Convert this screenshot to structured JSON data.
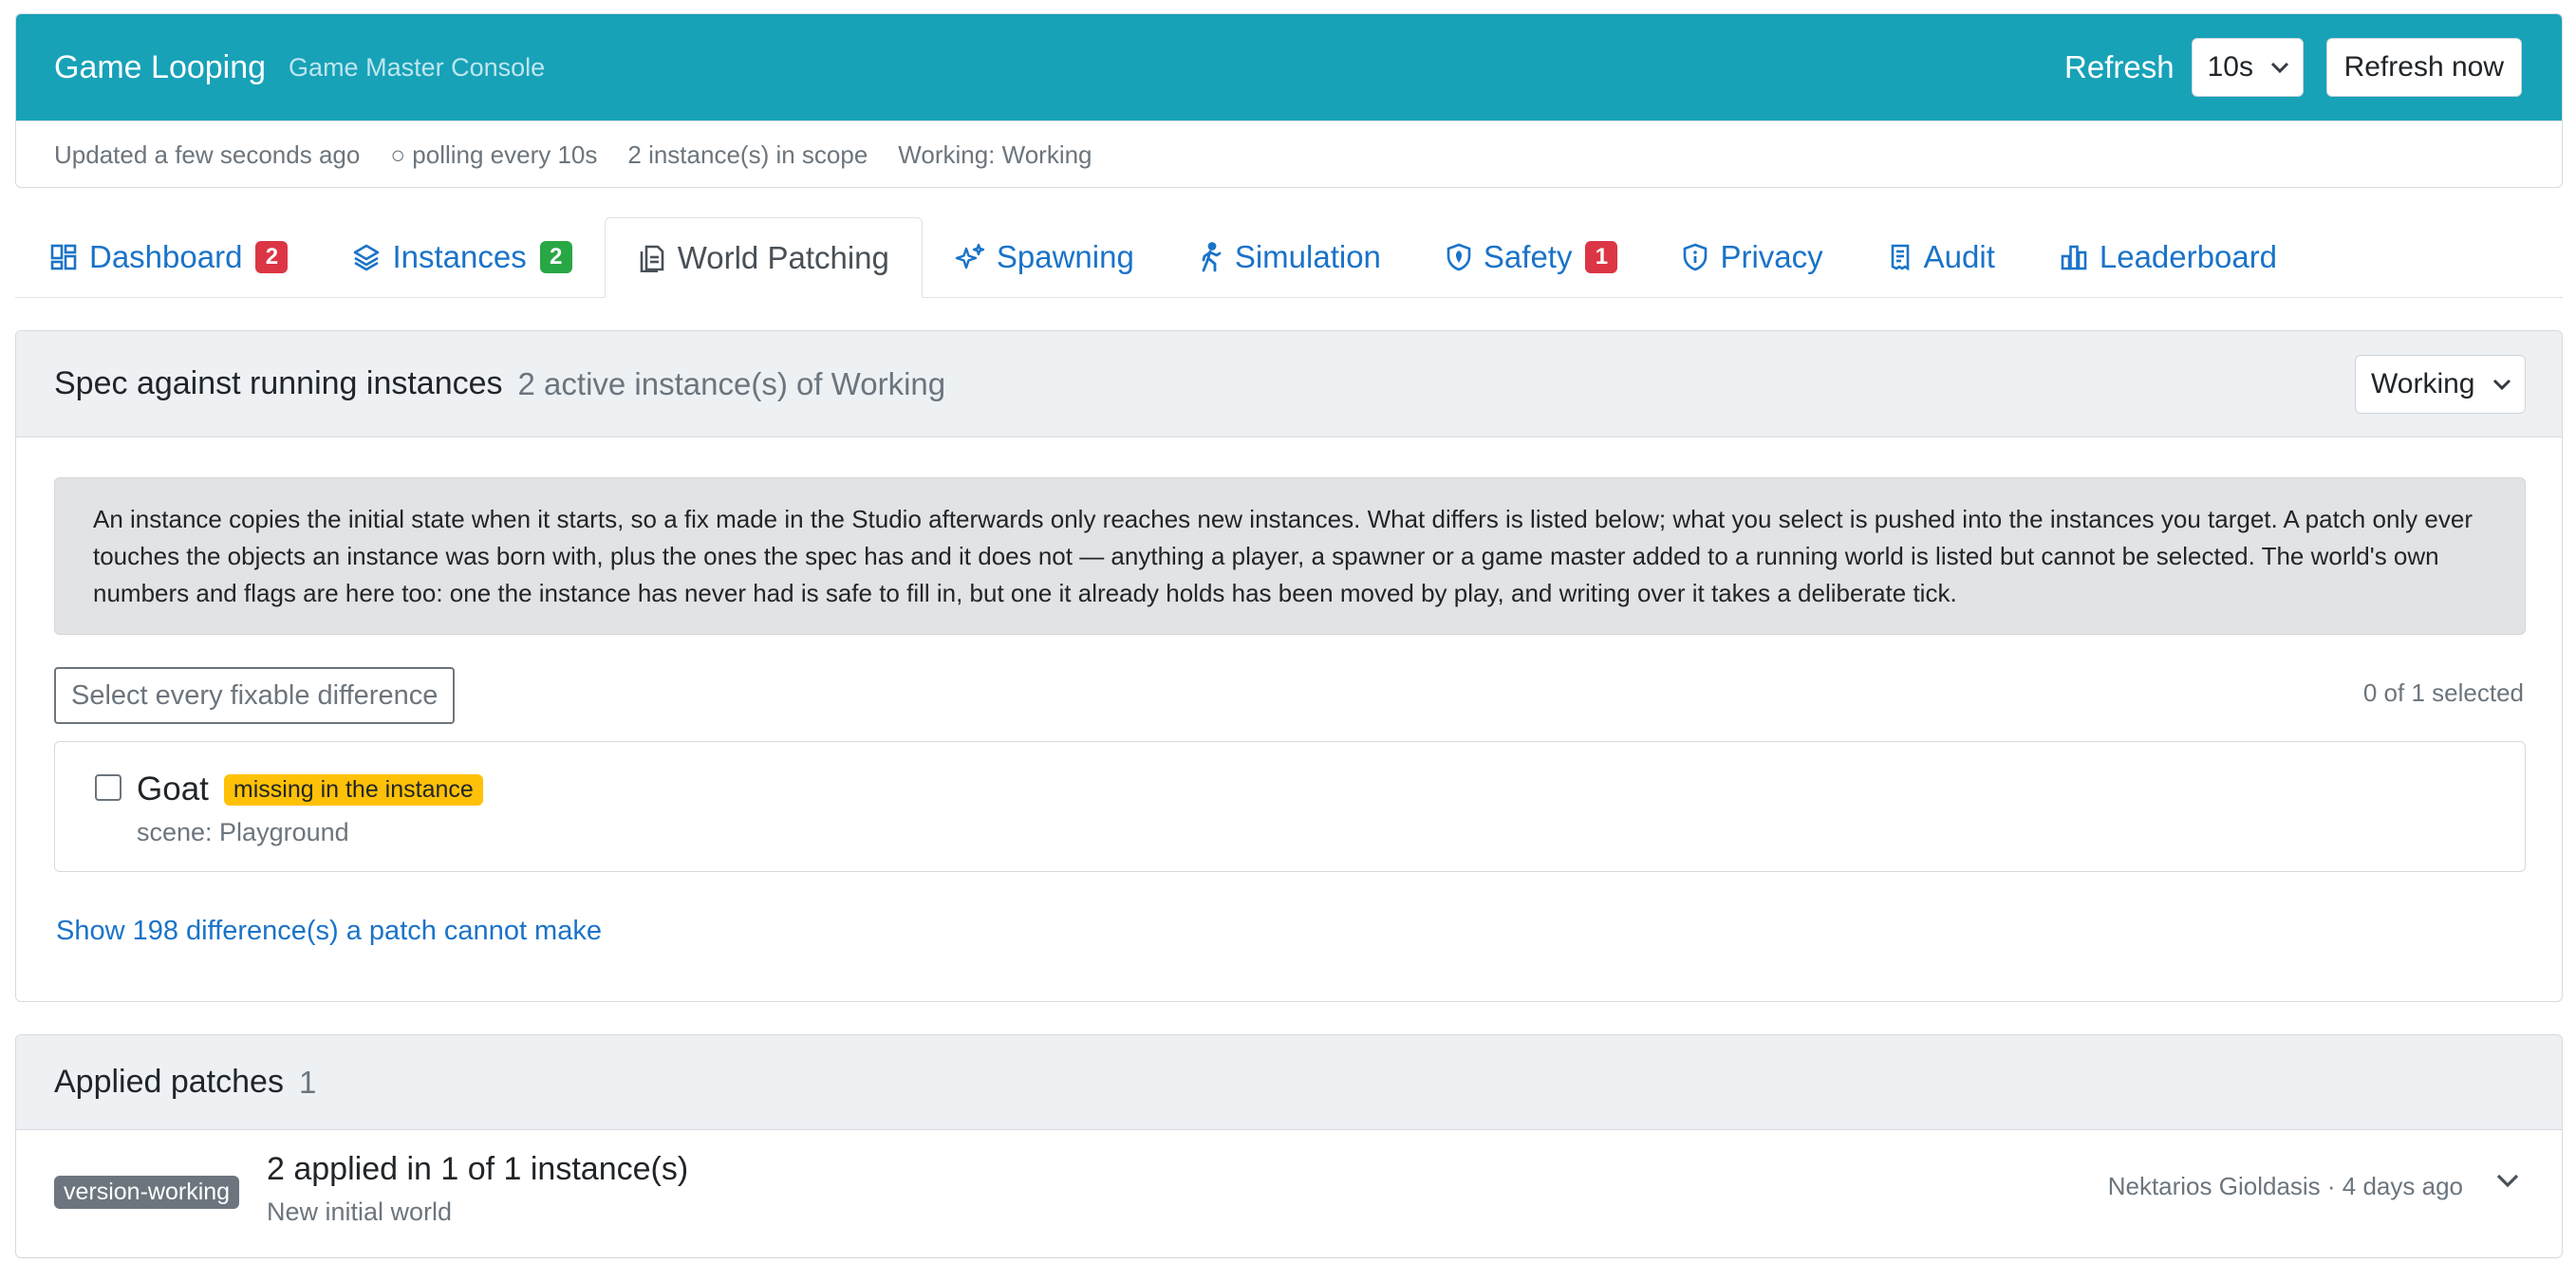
{
  "header": {
    "app_title": "Game Looping",
    "app_subtitle": "Game Master Console",
    "refresh_label": "Refresh",
    "refresh_interval": "10s",
    "refresh_now": "Refresh now",
    "accent_color": "#17a2b8"
  },
  "status": {
    "updated": "Updated a few seconds ago",
    "polling": "○ polling every 10s",
    "scope": "2 instance(s) in scope",
    "working": "Working: Working"
  },
  "tabs": [
    {
      "label": "Dashboard",
      "icon": "dashboard-icon",
      "badge": "2",
      "badge_color": "#dc3545"
    },
    {
      "label": "Instances",
      "icon": "layers-icon",
      "badge": "2",
      "badge_color": "#28a745"
    },
    {
      "label": "World Patching",
      "icon": "document-patch-icon",
      "active": true
    },
    {
      "label": "Spawning",
      "icon": "sparkles-icon"
    },
    {
      "label": "Simulation",
      "icon": "walking-person-icon"
    },
    {
      "label": "Safety",
      "icon": "shield-icon",
      "badge": "1",
      "badge_color": "#dc3545"
    },
    {
      "label": "Privacy",
      "icon": "shield-info-icon"
    },
    {
      "label": "Audit",
      "icon": "receipt-icon"
    },
    {
      "label": "Leaderboard",
      "icon": "bar-chart-icon"
    }
  ],
  "spec": {
    "title": "Spec against running instances",
    "subtitle": "2 active instance(s) of Working",
    "scope_select": "Working",
    "info": "An instance copies the initial state when it starts, so a fix made in the Studio afterwards only reaches new instances. What differs is listed below; what you select is pushed into the instances you target. A patch only ever touches the objects an instance was born with, plus the ones the spec has and it does not — anything a player, a spawner or a game master added to a running world is listed but cannot be selected. The world's own numbers and flags are here too: one the instance has never had is safe to fill in, but one it already holds has been moved by play, and writing over it takes a deliberate tick.",
    "select_all": "Select every fixable difference",
    "selected_count": "0 of 1 selected",
    "differences": [
      {
        "name": "Goat",
        "badge": "missing in the instance",
        "scene": "scene: Playground",
        "checked": false
      }
    ],
    "show_more": "Show 198 difference(s) a patch cannot make"
  },
  "patches": {
    "title": "Applied patches",
    "count": "1",
    "items": [
      {
        "tag": "version-working",
        "title": "2 applied in 1 of 1 instance(s)",
        "description": "New initial world",
        "meta": "Nektarios Gioldasis · 4 days ago"
      }
    ]
  }
}
